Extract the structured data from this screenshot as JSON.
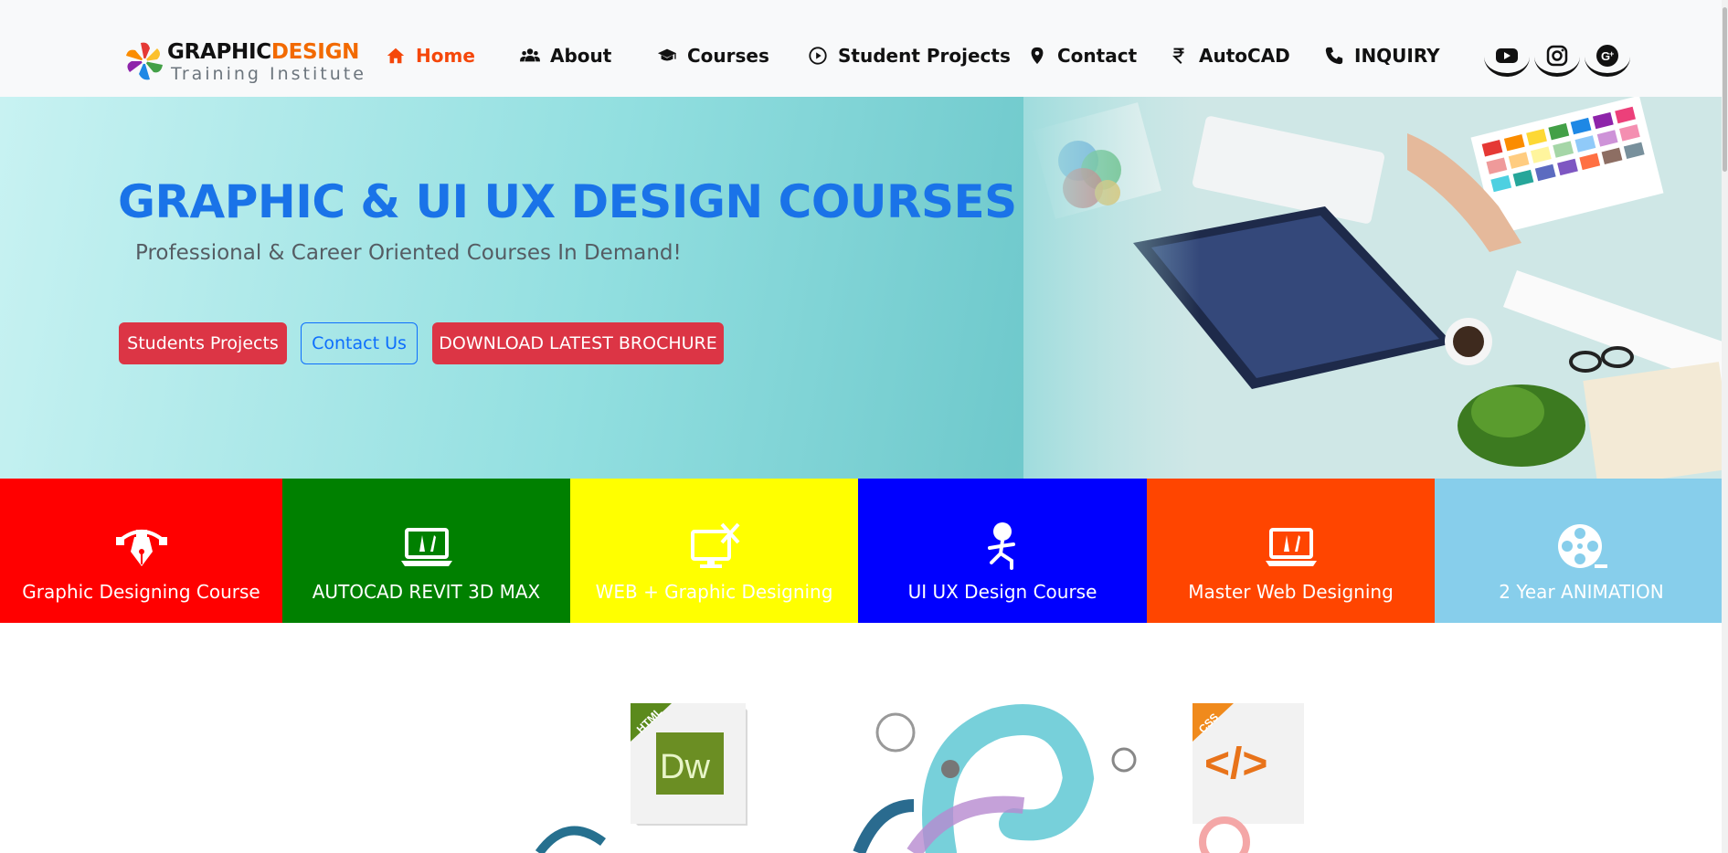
{
  "brand": {
    "name_part1": "GRAPHIC",
    "name_part2": "DESIGN",
    "tagline": "Training Institute"
  },
  "nav": {
    "items": [
      {
        "label": "Home",
        "icon": "home-icon",
        "active": true
      },
      {
        "label": "About",
        "icon": "users-icon"
      },
      {
        "label": "Courses",
        "icon": "graduation-cap-icon"
      },
      {
        "label": "Student Projects",
        "icon": "play-circle-icon"
      },
      {
        "label": "Contact",
        "icon": "map-pin-icon"
      },
      {
        "label": "AutoCAD",
        "icon": "rupee-icon"
      },
      {
        "label": "INQUIRY",
        "icon": "phone-icon"
      }
    ],
    "social": [
      "youtube-icon",
      "instagram-icon",
      "google-plus-icon"
    ]
  },
  "hero": {
    "title": "GRAPHIC & UI UX DESIGN COURSES",
    "subtitle": "Professional & Career Oriented Courses In Demand!",
    "buttons": {
      "students_projects": "Students Projects",
      "contact_us": "Contact Us",
      "download": "DOWNLOAD LATEST BROCHURE"
    }
  },
  "courses": [
    {
      "label": "Graphic Designing Course",
      "color": "#ff0000",
      "icon": "pen-tool-icon"
    },
    {
      "label": "AUTOCAD REVIT 3D MAX",
      "color": "#008000",
      "icon": "laptop-design-icon"
    },
    {
      "label": "WEB + Graphic Designing",
      "color": "#ffff00",
      "icon": "monitor-tools-icon"
    },
    {
      "label": "UI UX Design Course",
      "color": "#0000ff",
      "icon": "running-figure-icon"
    },
    {
      "label": "Master Web Designing",
      "color": "#ff4500",
      "icon": "laptop-design-icon"
    },
    {
      "label": "2 Year ANIMATION",
      "color": "#87ceeb",
      "icon": "film-reel-icon"
    }
  ],
  "showcase": {
    "left_badge": "HTML",
    "left_app": "Dw",
    "right_badge": "CSS",
    "right_app": "</>"
  },
  "colors": {
    "accent_orange": "#f5470a",
    "hero_title_blue": "#1a73e8",
    "button_red": "#dc3545",
    "button_blue": "#0d6efd"
  }
}
